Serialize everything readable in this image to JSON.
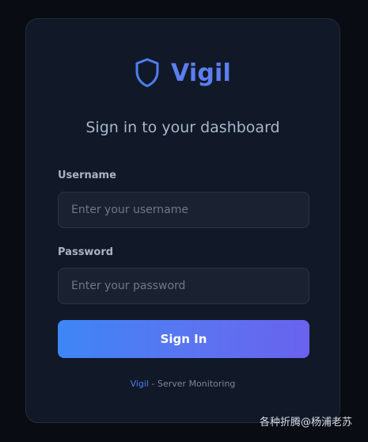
{
  "brand": {
    "name": "Vigil",
    "accent_color": "#5b7ef0",
    "icon": "shield-icon"
  },
  "login": {
    "subtitle": "Sign in to your dashboard",
    "username": {
      "label": "Username",
      "placeholder": "Enter your username",
      "value": ""
    },
    "password": {
      "label": "Password",
      "placeholder": "Enter your password",
      "value": ""
    },
    "submit_label": "Sign In"
  },
  "footer": {
    "link_text": "Vigil",
    "separator": " - ",
    "text": "Server Monitoring"
  },
  "watermark": {
    "text": "各种折腾@杨浦老苏"
  }
}
